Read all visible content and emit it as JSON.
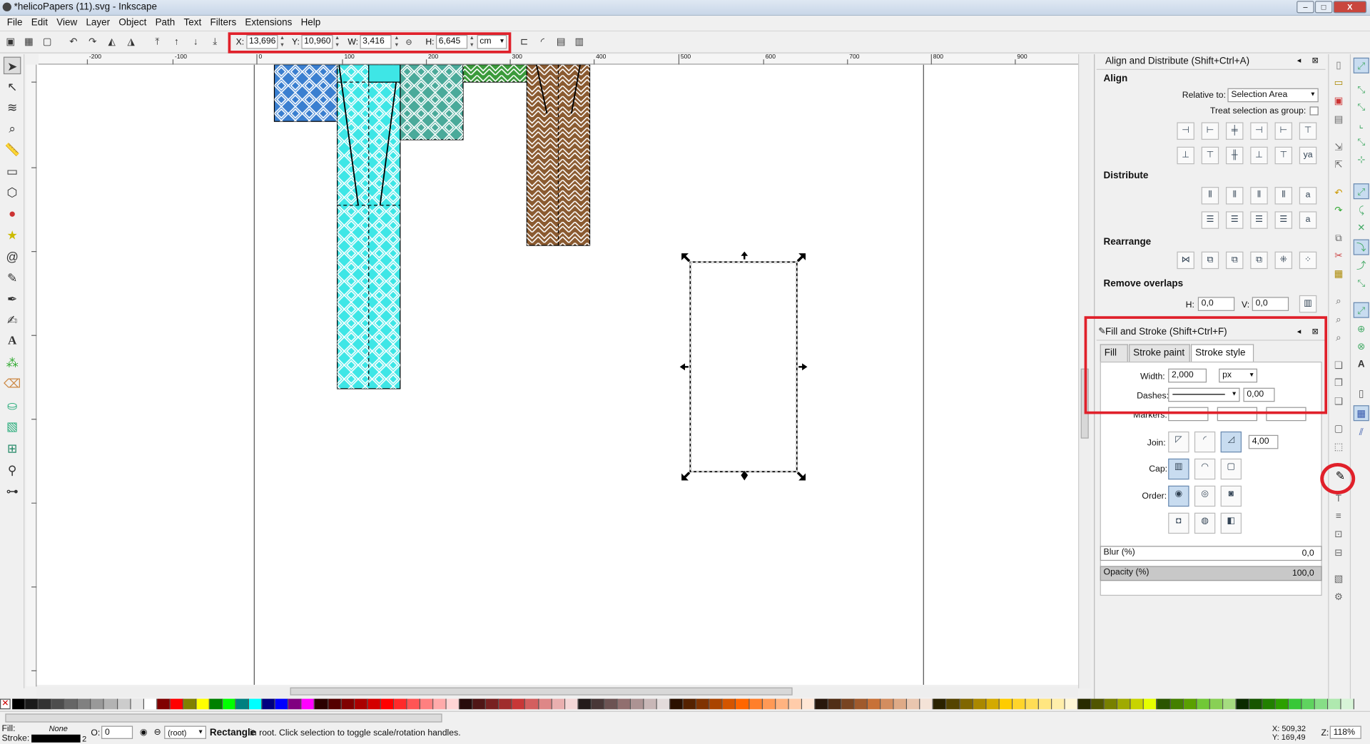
{
  "window": {
    "title": "*helicoPapers (11).svg - Inkscape",
    "min": "–",
    "max": "□",
    "close": "X"
  },
  "menu": [
    "File",
    "Edit",
    "View",
    "Layer",
    "Object",
    "Path",
    "Text",
    "Filters",
    "Extensions",
    "Help"
  ],
  "toolbar": {
    "x_label": "X:",
    "x": "13,696",
    "y_label": "Y:",
    "y": "10,960",
    "w_label": "W:",
    "w": "3,416",
    "h_label": "H:",
    "h": "6,645",
    "unit": "cm"
  },
  "ruler_labels": [
    "-200",
    "-100",
    "0",
    "100",
    "200",
    "300",
    "400",
    "500",
    "600",
    "700",
    "800",
    "900"
  ],
  "align_panel": {
    "title": "Align and Distribute (Shift+Ctrl+A)",
    "align_heading": "Align",
    "relative_label": "Relative to:",
    "relative_value": "Selection Area",
    "group_label": "Treat selection as group:",
    "distribute_heading": "Distribute",
    "rearrange_heading": "Rearrange",
    "overlaps_heading": "Remove overlaps",
    "h_label": "H:",
    "h_value": "0,0",
    "v_label": "V:",
    "v_value": "0,0"
  },
  "fill_stroke": {
    "title": "Fill and Stroke (Shift+Ctrl+F)",
    "tab_fill": "Fill",
    "tab_paint": "Stroke paint",
    "tab_style": "Stroke style",
    "width_label": "Width:",
    "width_value": "2,000",
    "width_unit": "px",
    "dashes_label": "Dashes:",
    "dashes_offset": "0,00",
    "markers_label": "Markers:",
    "join_label": "Join:",
    "miter_value": "4,00",
    "cap_label": "Cap:",
    "order_label": "Order:",
    "blur_label": "Blur (%)",
    "blur_value": "0,0",
    "opacity_label": "Opacity (%)",
    "opacity_value": "100,0"
  },
  "status": {
    "fill_label": "Fill:",
    "fill_value": "None",
    "stroke_label": "Stroke:",
    "stroke_width": "2",
    "o_label": "O:",
    "o_value": "0",
    "layer": "(root)",
    "message_bold": "Rectangle",
    "message": " in root. Click selection to toggle scale/rotation handles.",
    "x_coord": "X:  509,32",
    "y_coord": "Y:  169,49",
    "z_label": "Z:",
    "zoom": "118%"
  },
  "colors": {
    "accent_red": "#e0202a",
    "cyan": "#3ee6e6",
    "blue": "#3a7fd0",
    "teal": "#4aaa9a",
    "green": "#3a9a3a",
    "brown": "#8a5a30"
  },
  "palette": [
    "#000000",
    "#1a1a1a",
    "#333333",
    "#4d4d4d",
    "#666666",
    "#808080",
    "#999999",
    "#b3b3b3",
    "#cccccc",
    "#e6e6e6",
    "#ffffff",
    "#800000",
    "#ff0000",
    "#808000",
    "#ffff00",
    "#008000",
    "#00ff00",
    "#008080",
    "#00ffff",
    "#000080",
    "#0000ff",
    "#800080",
    "#ff00ff",
    "#2b0000",
    "#550000",
    "#800000",
    "#aa0000",
    "#d40000",
    "#ff0000",
    "#ff2a2a",
    "#ff5555",
    "#ff8080",
    "#ffaaaa",
    "#ffd5d5",
    "#280b0b",
    "#501616",
    "#782121",
    "#a02c2c",
    "#c83737",
    "#d35f5f",
    "#de8787",
    "#e9afaf",
    "#f4d7d7",
    "#241c1c",
    "#483737",
    "#6c5353",
    "#916f6f",
    "#ac9393",
    "#c8b7b7",
    "#e3dbdb",
    "#2b1100",
    "#552200",
    "#803300",
    "#aa4400",
    "#d45500",
    "#ff6600",
    "#ff7f2a",
    "#ff9955",
    "#ffb380",
    "#ffccaa",
    "#ffe6d5",
    "#28170b",
    "#502d16",
    "#784421",
    "#a05a2c",
    "#c87137",
    "#d38d5f",
    "#deaa87",
    "#e9c6af",
    "#f4e3d7",
    "#2b2200",
    "#554400",
    "#806600",
    "#aa8800",
    "#d4aa00",
    "#ffcc00",
    "#ffd42a",
    "#ffdd55",
    "#ffe680",
    "#ffeeaa",
    "#fff6d5",
    "#282b00",
    "#505500",
    "#788000",
    "#a0aa00",
    "#c8d400",
    "#e5ff00",
    "#2b5500",
    "#448000",
    "#5aa000",
    "#71c837",
    "#89d055",
    "#a5dc80",
    "#0b2b00",
    "#165500",
    "#218000",
    "#2ca000",
    "#37c837",
    "#5fd35f",
    "#87de87",
    "#afe9af",
    "#d7f4d7"
  ]
}
